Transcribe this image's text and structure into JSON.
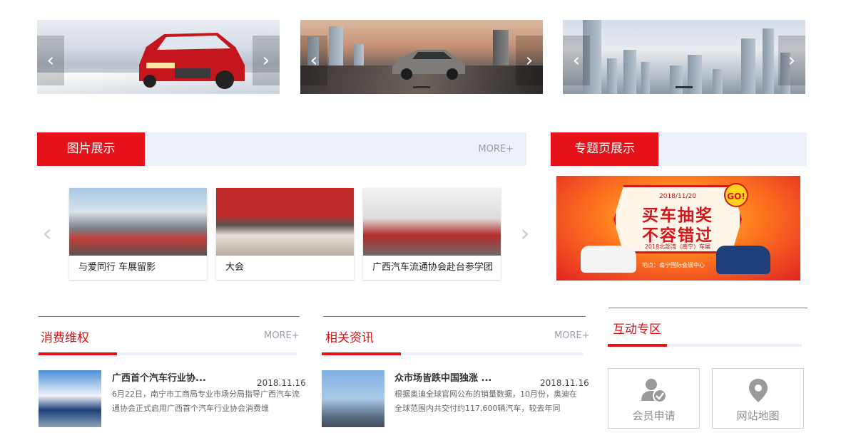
{
  "banners": [
    {
      "prev": "‹",
      "next": "›"
    },
    {
      "prev": "‹",
      "next": "›"
    },
    {
      "prev": "‹",
      "next": "›"
    }
  ],
  "gallery": {
    "title": "图片展示",
    "more": "MORE+",
    "prev": "‹",
    "next": "›",
    "items": [
      {
        "caption": "与爱同行 车展留影"
      },
      {
        "caption": "大会"
      },
      {
        "caption": "广西汽车流通协会赴台参学团"
      }
    ]
  },
  "special": {
    "title": "专题页展示",
    "promo": {
      "date": "2018/11/20",
      "line1": "买车抽奖",
      "line2": "不容错过",
      "sub": "2018北部湾（南宁）车展",
      "go": "GO!",
      "place": "地点：南宁国际会展中心"
    }
  },
  "consumer": {
    "title": "消费维权",
    "more": "MORE+",
    "news": {
      "title": "广西首个汽车行业协...",
      "date": "2018.11.16",
      "text": "6月22日，南宁市工商局专业市场分局指导广西汽车流通协会正式启用广西首个汽车行业协会消费维"
    }
  },
  "related": {
    "title": "相关资讯",
    "more": "MORE+",
    "news": {
      "title": "众市场皆跌中国独涨 ...",
      "date": "2018.11.16",
      "text": "根据奥迪全球官网公布的销量数据，10月份，奥迪在全球范围内共交付约117,600辆汽车，较去年同"
    }
  },
  "interactive": {
    "title": "互动专区",
    "member": "会员申请",
    "sitemap": "网站地图"
  },
  "colors": {
    "accent": "#e5121a",
    "bar": "#ecf1f9"
  }
}
